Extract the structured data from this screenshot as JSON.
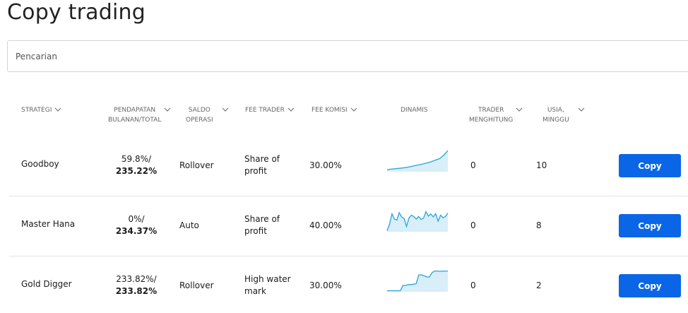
{
  "page": {
    "title": "Copy trading"
  },
  "search": {
    "placeholder": "Pencarian"
  },
  "table": {
    "headers": {
      "strategy": [
        "STRATEGI"
      ],
      "income": [
        "PENDAPATAN",
        "BULANAN/TOTAL"
      ],
      "balance": [
        "SALDO",
        "OPERASI"
      ],
      "trader_fee": [
        "FEE TRADER"
      ],
      "commission_fee": [
        "FEE KOMISI"
      ],
      "dynamics": [
        "DINAMIS"
      ],
      "trader_count": [
        "TRADER",
        "MENGHITUNG"
      ],
      "age": [
        "USIA,",
        "MINGGU"
      ]
    },
    "rows": [
      {
        "strategy": "Goodboy",
        "income_monthly": "59.8%/",
        "income_total": "235.22%",
        "balance": "Rollover",
        "trader_fee": [
          "Share of",
          "profit"
        ],
        "commission_fee": "30.00%",
        "dynamics": [
          0.1,
          0.12,
          0.14,
          0.16,
          0.18,
          0.21,
          0.25,
          0.29,
          0.33,
          0.37,
          0.42,
          0.48,
          0.55,
          0.62,
          0.78,
          1.0
        ],
        "trader_count": "0",
        "age": "10",
        "action": "Copy"
      },
      {
        "strategy": "Master Hana",
        "income_monthly": "0%/",
        "income_total": "234.37%",
        "balance": "Auto",
        "trader_fee": [
          "Share of",
          "profit"
        ],
        "commission_fee": "40.00%",
        "dynamics": [
          0.05,
          0.35,
          0.85,
          0.6,
          0.55,
          0.9,
          0.7,
          0.62,
          0.25,
          0.65,
          0.78,
          0.72,
          0.6,
          0.72,
          0.58,
          0.64,
          0.95,
          0.74,
          0.84,
          0.7,
          0.85,
          0.5,
          0.78,
          0.66,
          0.72,
          0.88
        ],
        "trader_count": "0",
        "age": "8",
        "action": "Copy"
      },
      {
        "strategy": "Gold Digger",
        "income_monthly": "233.82%/",
        "income_total": "233.82%",
        "balance": "Rollover",
        "trader_fee": [
          "High water",
          "mark"
        ],
        "commission_fee": "30.00%",
        "dynamics": [
          0.05,
          0.05,
          0.05,
          0.05,
          0.05,
          0.05,
          0.3,
          0.3,
          0.34,
          0.34,
          0.36,
          0.38,
          0.8,
          0.8,
          0.76,
          0.7,
          0.7,
          0.9,
          0.98,
          0.98,
          0.97,
          0.97,
          0.98,
          0.98
        ],
        "trader_count": "0",
        "age": "2",
        "action": "Copy"
      }
    ]
  },
  "colors": {
    "accent": "#0a66e6",
    "sparkline_stroke": "#29a3d9",
    "sparkline_fill": "#d8eef8",
    "row_divider": "#e3e3e3"
  }
}
